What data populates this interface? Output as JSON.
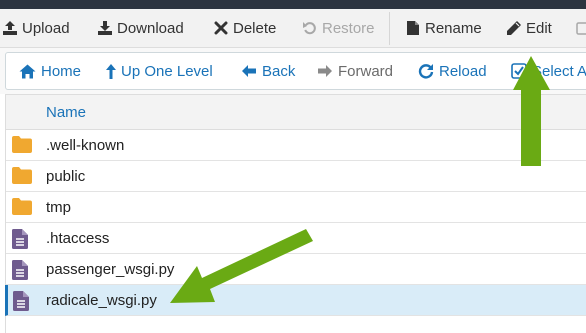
{
  "toolbar": {
    "upload": "Upload",
    "download": "Download",
    "delete": "Delete",
    "restore": "Restore",
    "rename": "Rename",
    "edit": "Edit"
  },
  "navbar": {
    "home": "Home",
    "up_one_level": "Up One Level",
    "back": "Back",
    "forward": "Forward",
    "reload": "Reload",
    "select_all": "Select All"
  },
  "table": {
    "header_name": "Name",
    "rows": [
      {
        "name": ".well-known",
        "type": "folder"
      },
      {
        "name": "public",
        "type": "folder"
      },
      {
        "name": "tmp",
        "type": "folder"
      },
      {
        "name": ".htaccess",
        "type": "file"
      },
      {
        "name": "passenger_wsgi.py",
        "type": "file"
      },
      {
        "name": "radicale_wsgi.py",
        "type": "file",
        "selected": true
      }
    ]
  },
  "colors": {
    "accent": "#1a73b8",
    "folder": "#f0a830",
    "file": "#6f5b8e",
    "annotation_arrow": "#6aaa14",
    "selected_row": "#d9ecf8"
  }
}
